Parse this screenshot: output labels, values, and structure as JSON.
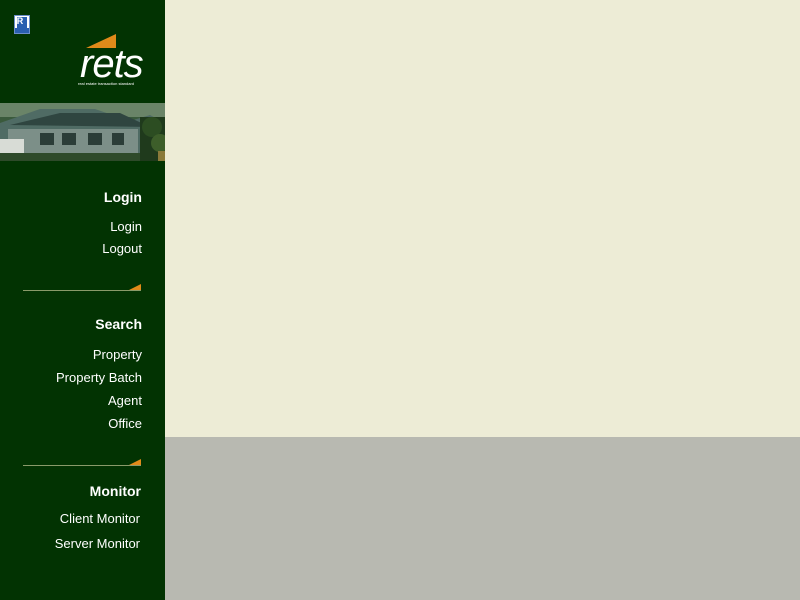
{
  "logo": {
    "wordmark": "rets",
    "tagline": "real  estate  transaction  standard"
  },
  "realtor_badge": {
    "letter": "R"
  },
  "colors": {
    "sidebar": "#023302",
    "content": "#edecd6",
    "footer": "#b8b9b1",
    "accent": "#e08a1a"
  },
  "nav": {
    "login": {
      "heading": "Login",
      "items": [
        "Login",
        "Logout"
      ]
    },
    "search": {
      "heading": "Search",
      "items": [
        "Property",
        "Property Batch",
        "Agent",
        "Office"
      ]
    },
    "monitor": {
      "heading": "Monitor",
      "items": [
        "Client Monitor",
        "Server Monitor"
      ]
    }
  }
}
